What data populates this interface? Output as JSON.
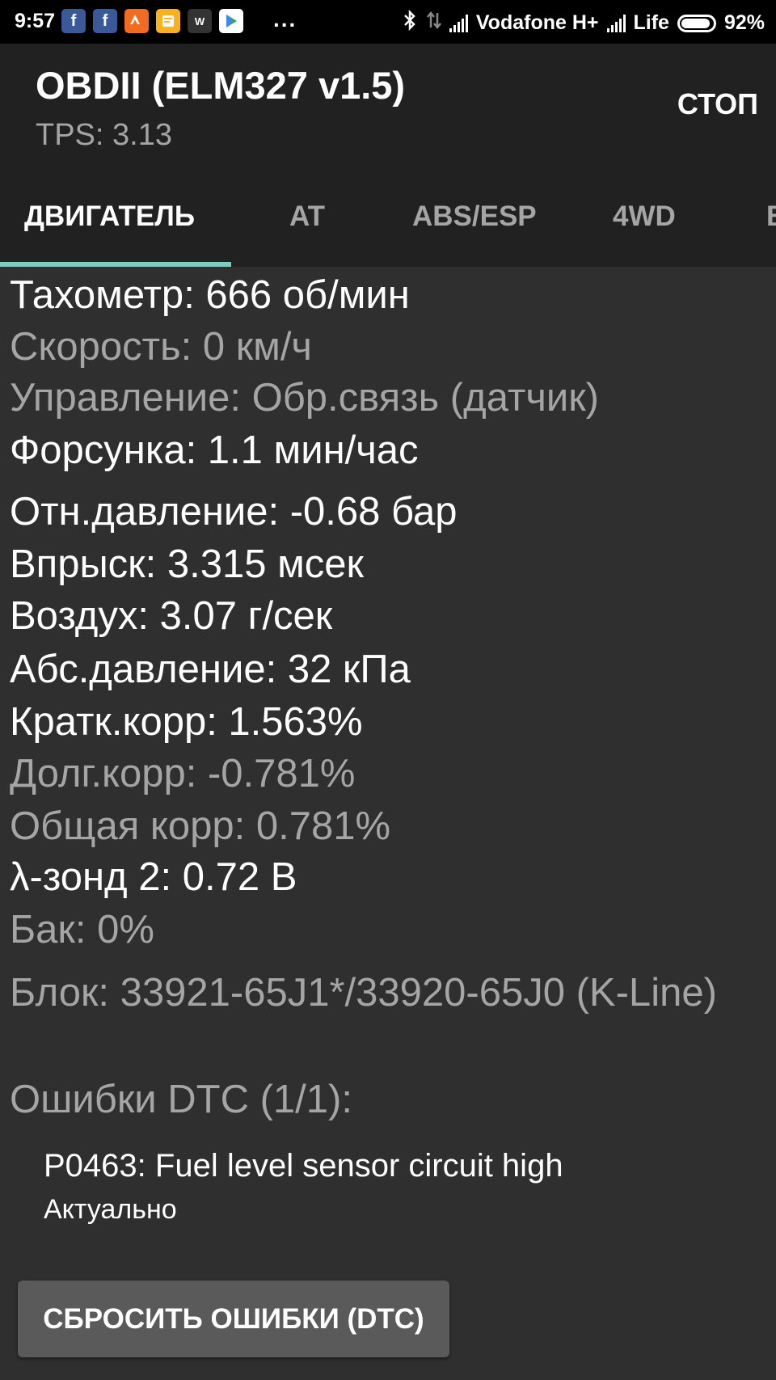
{
  "status_bar": {
    "time": "9:57",
    "dots": "...",
    "carrier1": "Vodafone H+",
    "carrier2": "Life",
    "battery": "92%",
    "battery_level": 0.92,
    "icons": [
      "facebook-icon",
      "facebook-icon",
      "strava-icon",
      "notes-icon",
      "w-app-icon",
      "play-store-icon"
    ]
  },
  "app_bar": {
    "title": "OBDII (ELM327 v1.5)",
    "subtitle": "TPS: 3.13",
    "stop_label": "СТОП"
  },
  "tabs": [
    {
      "label": "ДВИГАТЕЛЬ",
      "active": true
    },
    {
      "label": "AT",
      "active": false
    },
    {
      "label": "ABS/ESP",
      "active": false
    },
    {
      "label": "4WD",
      "active": false
    },
    {
      "label": "В",
      "active": false
    }
  ],
  "params": [
    {
      "text": "Тахометр: 666 об/мин",
      "dim": false
    },
    {
      "text": "Скорость: 0 км/ч",
      "dim": true
    },
    {
      "text": "Управление: Обр.связь (датчик)",
      "dim": true
    },
    {
      "text": "Форсунка: 1.1 мин/час",
      "dim": false
    },
    {
      "text": "Отн.давление: -0.68 бар",
      "dim": false
    },
    {
      "text": "Впрыск: 3.315 мсек",
      "dim": false
    },
    {
      "text": "Воздух: 3.07 г/сек",
      "dim": false
    },
    {
      "text": "Абс.давление: 32 кПа",
      "dim": false
    },
    {
      "text": "Кратк.корр: 1.563%",
      "dim": false
    },
    {
      "text": "Долг.корр: -0.781%",
      "dim": true
    },
    {
      "text": "Общая корр: 0.781%",
      "dim": true
    },
    {
      "text": "λ-зонд 2: 0.72 В",
      "dim": false
    },
    {
      "text": "Бак: 0%",
      "dim": true
    }
  ],
  "block_info": "Блок: 33921-65J1*/33920-65J0 (K-Line)",
  "dtc_header": "Ошибки DTC (1/1):",
  "dtc": {
    "code": "P0463: Fuel level sensor circuit high",
    "status": "Актуально"
  },
  "reset_button": "СБРОСИТЬ ОШИБКИ (DTC)",
  "colors": {
    "background": "#2f2f2f",
    "app_bar": "#212121",
    "indicator": "#80cbc4",
    "dim_text": "#a5a5a5",
    "button": "#5a5a5a"
  }
}
